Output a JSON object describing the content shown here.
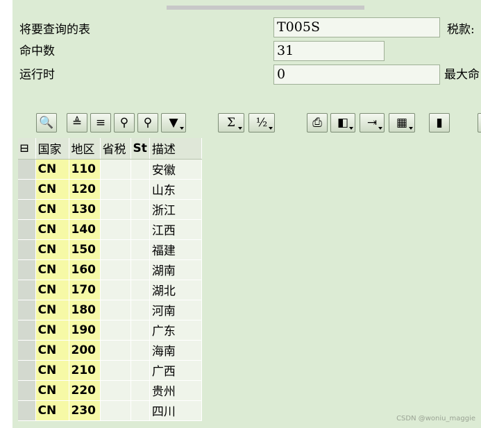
{
  "form": {
    "table_label": "将要查询的表",
    "table_value": "T005S",
    "tax_label": "税款:",
    "hits_label": "命中数",
    "hits_value": "31",
    "runtime_label": "运行时",
    "runtime_value": "0",
    "max_label": "最大命"
  },
  "toolbar": {
    "icons": [
      "details-icon",
      "sort-ascending-icon",
      "sort-descending-icon",
      "find-icon",
      "find-next-icon",
      "filter-icon",
      "sum-icon",
      "subtotal-icon",
      "print-icon",
      "print-preview-icon",
      "export-icon",
      "layout-icon",
      "chart-icon",
      "more-icon"
    ]
  },
  "grid": {
    "columns": [
      "国家",
      "地区",
      "省税",
      "St",
      "描述"
    ],
    "rows": [
      {
        "country": "CN",
        "region": "110",
        "desc": "安徽"
      },
      {
        "country": "CN",
        "region": "120",
        "desc": "山东"
      },
      {
        "country": "CN",
        "region": "130",
        "desc": "浙江"
      },
      {
        "country": "CN",
        "region": "140",
        "desc": "江西"
      },
      {
        "country": "CN",
        "region": "150",
        "desc": "福建"
      },
      {
        "country": "CN",
        "region": "160",
        "desc": "湖南"
      },
      {
        "country": "CN",
        "region": "170",
        "desc": "湖北"
      },
      {
        "country": "CN",
        "region": "180",
        "desc": "河南"
      },
      {
        "country": "CN",
        "region": "190",
        "desc": "广东"
      },
      {
        "country": "CN",
        "region": "200",
        "desc": "海南"
      },
      {
        "country": "CN",
        "region": "210",
        "desc": "广西"
      },
      {
        "country": "CN",
        "region": "220",
        "desc": "贵州"
      },
      {
        "country": "CN",
        "region": "230",
        "desc": "四川"
      }
    ]
  },
  "watermark": "CSDN @woniu_maggie"
}
